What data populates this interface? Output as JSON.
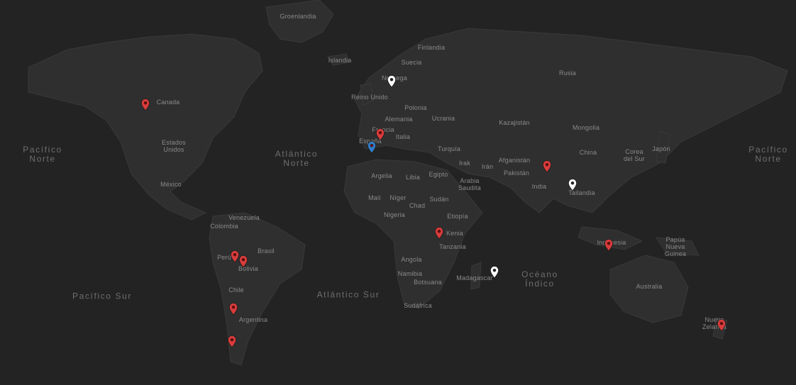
{
  "map": {
    "colors": {
      "ocean": "#232323",
      "land": "#2f2f2f",
      "border": "#3a3a3a",
      "label": "#8a8a8a",
      "ocean_label": "#6e6e6e"
    },
    "ocean_labels": [
      {
        "id": "pacifico-norte-left",
        "text": "Pacífico\nNorte"
      },
      {
        "id": "atlantico-norte",
        "text": "Atlántico\nNorte"
      },
      {
        "id": "pacifico-norte-right",
        "text": "Pacífico\nNorte"
      },
      {
        "id": "pacifico-sur",
        "text": "Pacífico Sur"
      },
      {
        "id": "atlantico-sur",
        "text": "Atlántico Sur"
      },
      {
        "id": "oceano-indico",
        "text": "Océano\nÍndico"
      }
    ],
    "country_labels": [
      {
        "id": "groenlandia",
        "text": "Groenlandia"
      },
      {
        "id": "islandia",
        "text": "Islandia"
      },
      {
        "id": "finlandia",
        "text": "Finlandia"
      },
      {
        "id": "suecia",
        "text": "Suecia"
      },
      {
        "id": "noruega",
        "text": "Noruega"
      },
      {
        "id": "rusia",
        "text": "Rusia"
      },
      {
        "id": "reino-unido",
        "text": "Reino Unido"
      },
      {
        "id": "polonia",
        "text": "Polonia"
      },
      {
        "id": "alemania",
        "text": "Alemania"
      },
      {
        "id": "ucrania",
        "text": "Ucrania"
      },
      {
        "id": "francia",
        "text": "Francia"
      },
      {
        "id": "kazajistan",
        "text": "Kazajistán"
      },
      {
        "id": "mongolia",
        "text": "Mongolia"
      },
      {
        "id": "canada",
        "text": "Canada"
      },
      {
        "id": "italia",
        "text": "Italia"
      },
      {
        "id": "espana",
        "text": "España"
      },
      {
        "id": "turquia",
        "text": "Turquía"
      },
      {
        "id": "china",
        "text": "China"
      },
      {
        "id": "corea-del-sur",
        "text": "Corea\ndel Sur"
      },
      {
        "id": "japon",
        "text": "Japón"
      },
      {
        "id": "estados-unidos",
        "text": "Estados\nUnidos"
      },
      {
        "id": "afganistan",
        "text": "Afganistán"
      },
      {
        "id": "irak",
        "text": "Irak"
      },
      {
        "id": "iran",
        "text": "Irán"
      },
      {
        "id": "pakistan",
        "text": "Pakistán"
      },
      {
        "id": "argelia",
        "text": "Argelia"
      },
      {
        "id": "libia",
        "text": "Libia"
      },
      {
        "id": "egipto",
        "text": "Egipto"
      },
      {
        "id": "arabia-saudita",
        "text": "Arabia\nSaudita"
      },
      {
        "id": "india",
        "text": "India"
      },
      {
        "id": "mexico",
        "text": "México"
      },
      {
        "id": "tailandia",
        "text": "Tailandia"
      },
      {
        "id": "mali",
        "text": "Malí"
      },
      {
        "id": "niger",
        "text": "Níger"
      },
      {
        "id": "sudan",
        "text": "Sudán"
      },
      {
        "id": "chad",
        "text": "Chad"
      },
      {
        "id": "nigeria",
        "text": "Nigeria"
      },
      {
        "id": "etiopia",
        "text": "Etiopía"
      },
      {
        "id": "venezuela",
        "text": "Venezuela"
      },
      {
        "id": "colombia",
        "text": "Colombia"
      },
      {
        "id": "kenia",
        "text": "Kenia"
      },
      {
        "id": "tanzania",
        "text": "Tanzania"
      },
      {
        "id": "indonesia",
        "text": "Indonesia"
      },
      {
        "id": "papua-nueva-guinea",
        "text": "Papúa\nNueva\nGuinea"
      },
      {
        "id": "brasil",
        "text": "Brasil"
      },
      {
        "id": "peru",
        "text": "Perú"
      },
      {
        "id": "bolivia",
        "text": "Bolivia"
      },
      {
        "id": "angola",
        "text": "Angola"
      },
      {
        "id": "namibia",
        "text": "Namibia"
      },
      {
        "id": "botsuana",
        "text": "Botsuana"
      },
      {
        "id": "madagascar",
        "text": "Madagascar"
      },
      {
        "id": "australia",
        "text": "Australia"
      },
      {
        "id": "chile",
        "text": "Chile"
      },
      {
        "id": "sudafrica",
        "text": "Sudáfrica"
      },
      {
        "id": "argentina",
        "text": "Argentina"
      },
      {
        "id": "nueva-zelanda",
        "text": "Nueva\nZelanda"
      }
    ],
    "markers": [
      {
        "id": "canada",
        "color": "red"
      },
      {
        "id": "noruega",
        "color": "white"
      },
      {
        "id": "francia",
        "color": "red"
      },
      {
        "id": "espana",
        "color": "blue"
      },
      {
        "id": "india",
        "color": "red"
      },
      {
        "id": "tailandia",
        "color": "white"
      },
      {
        "id": "kenia",
        "color": "red"
      },
      {
        "id": "madagascar",
        "color": "white"
      },
      {
        "id": "indonesia",
        "color": "red"
      },
      {
        "id": "peru",
        "color": "red"
      },
      {
        "id": "bolivia",
        "color": "red"
      },
      {
        "id": "chile-north",
        "color": "red"
      },
      {
        "id": "chile-south",
        "color": "red"
      },
      {
        "id": "nueva-zelanda",
        "color": "red"
      }
    ],
    "marker_colors": {
      "red": "#d93c3c",
      "white": "#ffffff",
      "blue": "#2f7ec9"
    }
  }
}
